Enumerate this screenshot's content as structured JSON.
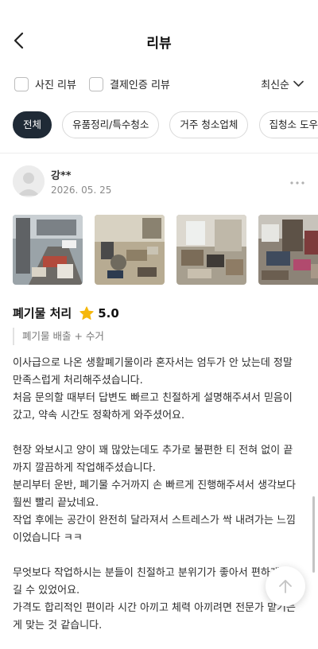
{
  "header": {
    "title": "리뷰"
  },
  "filters": {
    "photo_review": "사진 리뷰",
    "verified_review": "결제인증 리뷰",
    "sort_label": "최신순"
  },
  "categories": [
    {
      "label": "전체",
      "active": true
    },
    {
      "label": "유품정리/특수청소",
      "active": false
    },
    {
      "label": "거주 청소업체",
      "active": false
    },
    {
      "label": "집청소 도우미",
      "active": false
    }
  ],
  "review": {
    "author": "강**",
    "date": "2026. 05. 25",
    "service": "폐기물 처리",
    "rating": "5.0",
    "tag": "폐기물 배출 + 수거",
    "paragraphs": [
      "이사급으로 나온 생활폐기물이라 혼자서는 엄두가 안 났는데 정말 만족스럽게 처리해주셨습니다.",
      "처음 문의할 때부터 답변도 빠르고 친절하게 설명해주셔서 믿음이 갔고, 약속 시간도 정확하게 와주셨어요.",
      "",
      "현장 와보시고 양이 꽤 많았는데도 추가로 불편한 티 전혀 없이 끝까지 깔끔하게 작업해주셨습니다.",
      "분리부터 운반, 폐기물 수거까지 손 빠르게 진행해주셔서 생각보다 훨씬 빨리 끝났네요.",
      "작업 후에는 공간이 완전히 달라져서 스트레스가 싹 내려가는 느낌이었습니다 ㅋㅋ",
      "",
      "무엇보다 작업하시는 분들이 친절하고 분위기가 좋아서 편하게 맡길 수 있었어요.",
      "가격도 합리적인 편이라 시간 아끼고 체력 아끼려면 전문가 맡기는 게 맞는 것 같습니다."
    ]
  },
  "colors": {
    "active_chip": "#1f2a36",
    "star": "#f5b70a",
    "date": "#8a8a8a"
  },
  "icons": [
    "back-arrow-icon",
    "chevron-down-icon",
    "more-icon",
    "star-icon",
    "arrow-up-icon"
  ]
}
